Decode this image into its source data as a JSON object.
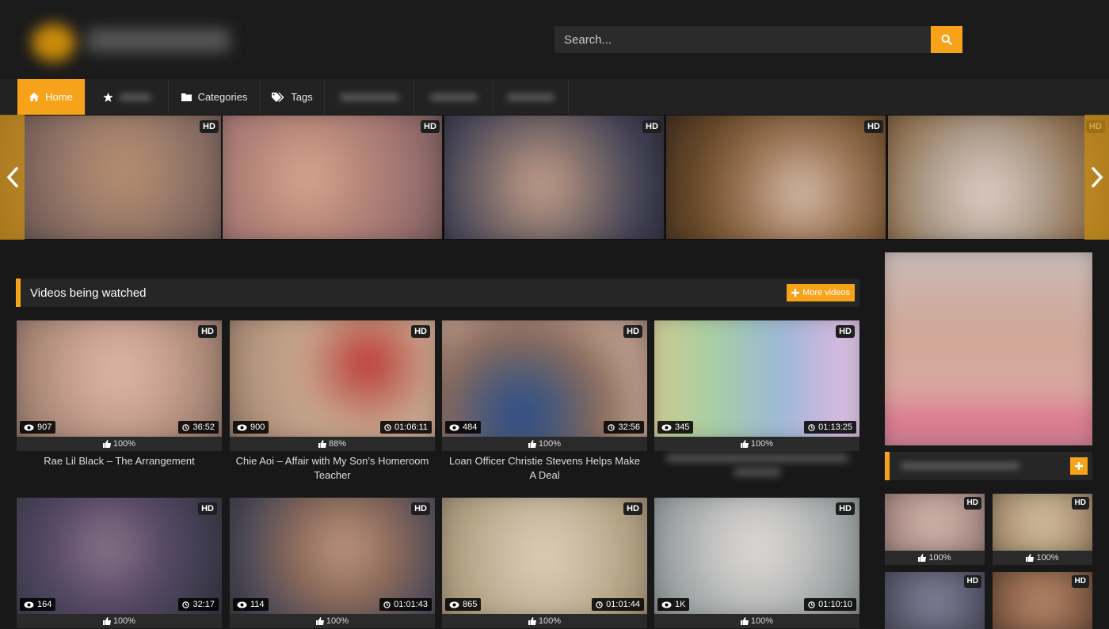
{
  "search": {
    "placeholder": "Search..."
  },
  "nav": {
    "items": [
      {
        "label": "Home",
        "icon": "home-icon",
        "active": true
      },
      {
        "label": "",
        "icon": "star-icon",
        "active": false
      },
      {
        "label": "Categories",
        "icon": "folder-icon",
        "active": false
      },
      {
        "label": "Tags",
        "icon": "tags-icon",
        "active": false
      },
      {
        "label": "",
        "icon": "",
        "active": false
      },
      {
        "label": "",
        "icon": "",
        "active": false
      },
      {
        "label": "",
        "icon": "",
        "active": false
      }
    ]
  },
  "carousel": {
    "slides": [
      {
        "badge": "HD"
      },
      {
        "badge": "HD"
      },
      {
        "badge": "HD"
      },
      {
        "badge": "HD"
      },
      {
        "badge": "HD"
      }
    ]
  },
  "section": {
    "title": "Videos being watched",
    "more_label": "More videos"
  },
  "videos": [
    {
      "badge": "HD",
      "views": "907",
      "duration": "36:52",
      "rating": "100%",
      "title": "Rae Lil Black – The Arrangement"
    },
    {
      "badge": "HD",
      "views": "900",
      "duration": "01:06:11",
      "rating": "88%",
      "title": "Chie Aoi – Affair with My Son’s Homeroom Teacher"
    },
    {
      "badge": "HD",
      "views": "484",
      "duration": "32:56",
      "rating": "100%",
      "title": "Loan Officer Christie Stevens Helps Make A Deal"
    },
    {
      "badge": "HD",
      "views": "345",
      "duration": "01:13:25",
      "rating": "100%",
      "title": ""
    },
    {
      "badge": "HD",
      "views": "164",
      "duration": "32:17",
      "rating": "100%",
      "title": ""
    },
    {
      "badge": "HD",
      "views": "114",
      "duration": "01:01:43",
      "rating": "100%",
      "title": ""
    },
    {
      "badge": "HD",
      "views": "865",
      "duration": "01:01:44",
      "rating": "100%",
      "title": ""
    },
    {
      "badge": "HD",
      "views": "1K",
      "duration": "01:10:10",
      "rating": "100%",
      "title": ""
    }
  ],
  "sidebar": {
    "head_title": "",
    "thumbs": [
      {
        "badge": "HD",
        "rating": "100%"
      },
      {
        "badge": "HD",
        "rating": "100%"
      },
      {
        "badge": "HD",
        "rating": ""
      },
      {
        "badge": "HD",
        "rating": ""
      }
    ]
  },
  "colors": {
    "accent": "#f7a31a",
    "background": "#181818",
    "panel": "#262626"
  }
}
